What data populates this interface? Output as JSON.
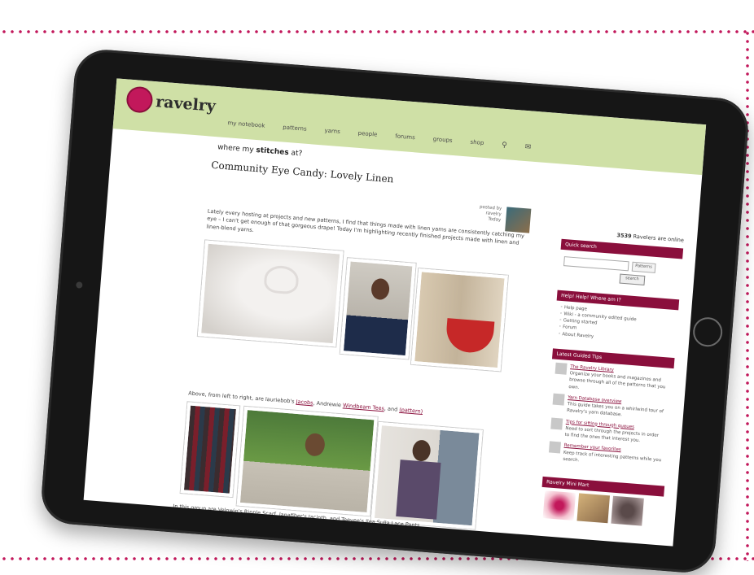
{
  "site": {
    "name": "ravelry",
    "nav": [
      "my notebook",
      "patterns",
      "yarns",
      "people",
      "forums",
      "groups",
      "shop"
    ],
    "tagline_prefix": "where my ",
    "tagline_bold": "stitches",
    "tagline_suffix": " at?"
  },
  "article": {
    "title": "Community Eye Candy: Lovely Linen",
    "byline": [
      "posted by",
      "ravelry",
      "Today"
    ],
    "paragraph1": "Lately every hosting at projects and new patterns, I find that things made with linen yarns are consistently catching my eye – I can't get enough of that gorgeous drape! Today I'm highlighting recently finished projects made with linen and linen-blend yarns.",
    "paragraph2_prefix": "Above, from left to right, are lauriebob's ",
    "paragraph2_link1": "Jacobs",
    "paragraph2_mid": ", Andrewie ",
    "paragraph2_link2": "Windbeam Tees",
    "paragraph2_suffix": ", and ",
    "paragraph2_link3": "(pattern)",
    "paragraph3": "In this group are Velowin's Ripple Scarf, lanafiber's Jacinth, and Teevee's Ilea Sulla Lace Pants."
  },
  "sidebar": {
    "online_count": "3539",
    "online_text": " Ravelers are online",
    "quick_search_title": "Quick search",
    "search_select": "Patterns",
    "search_button": "search",
    "help_title": "Help! Help! Where am I?",
    "help_items": [
      "Help page",
      "Wiki - a community edited guide",
      "Getting started",
      "Forum",
      "About Ravelry"
    ],
    "tips_title": "Latest Guided Tips",
    "tips": [
      {
        "title": "The Ravelry Library",
        "text": "Organize your books and magazines and browse through all of the patterns that you own."
      },
      {
        "title": "Yarn Database overview",
        "text": "This guide takes you on a whirlwind tour of Ravelry's yarn database."
      },
      {
        "title": "Tips for sifting through queues",
        "text": "Need to sort through the projects in order to find the ones that interest you."
      },
      {
        "title": "Remember your favorites",
        "text": "Keep track of interesting patterns while you search."
      }
    ],
    "ad_title": "Ravelry Mini Mart"
  },
  "colors": {
    "header_green": "#cfe0a6",
    "brand_maroon": "#8a0f3c",
    "logo_pink": "#c2185b",
    "dotted_border": "#c2185b"
  }
}
